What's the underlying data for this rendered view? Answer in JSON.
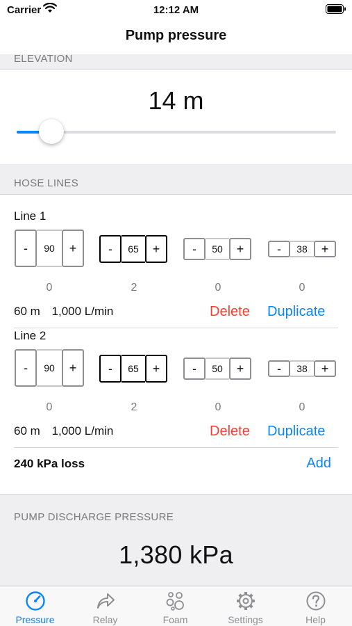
{
  "status_bar": {
    "carrier": "Carrier",
    "time": "12:12 AM"
  },
  "nav": {
    "title": "Pump pressure"
  },
  "elevation": {
    "header": "ELEVATION",
    "value": "14 m",
    "slider_fraction": 0.07,
    "accent_color": "#0a84ff"
  },
  "hose_lines": {
    "header": "HOSE LINES",
    "lines": [
      {
        "title": "Line 1",
        "steppers": [
          {
            "minus": "-",
            "value": "90",
            "plus": "+",
            "count": "0"
          },
          {
            "minus": "-",
            "value": "65",
            "plus": "+",
            "count": "2"
          },
          {
            "minus": "-",
            "value": "50",
            "plus": "+",
            "count": "0"
          },
          {
            "minus": "-",
            "value": "38",
            "plus": "+",
            "count": "0"
          }
        ],
        "length": "60 m",
        "flow": "1,000 L/min",
        "delete_label": "Delete",
        "duplicate_label": "Duplicate"
      },
      {
        "title": "Line 2",
        "steppers": [
          {
            "minus": "-",
            "value": "90",
            "plus": "+",
            "count": "0"
          },
          {
            "minus": "-",
            "value": "65",
            "plus": "+",
            "count": "2"
          },
          {
            "minus": "-",
            "value": "50",
            "plus": "+",
            "count": "0"
          },
          {
            "minus": "-",
            "value": "38",
            "plus": "+",
            "count": "0"
          }
        ],
        "length": "60 m",
        "flow": "1,000 L/min",
        "delete_label": "Delete",
        "duplicate_label": "Duplicate"
      }
    ],
    "loss": "240 kPa loss",
    "add_label": "Add"
  },
  "pump_discharge": {
    "header": "PUMP DISCHARGE PRESSURE",
    "value": "1,380 kPa"
  },
  "tabs": [
    {
      "label": "Pressure",
      "icon": "gauge-icon",
      "active": true
    },
    {
      "label": "Relay",
      "icon": "share-arrow-icon",
      "active": false
    },
    {
      "label": "Foam",
      "icon": "bubbles-icon",
      "active": false
    },
    {
      "label": "Settings",
      "icon": "gear-icon",
      "active": false
    },
    {
      "label": "Help",
      "icon": "question-icon",
      "active": false
    }
  ],
  "colors": {
    "accent": "#0a84ff",
    "destructive": "#ff3b30",
    "section_bg": "#efeff1"
  }
}
